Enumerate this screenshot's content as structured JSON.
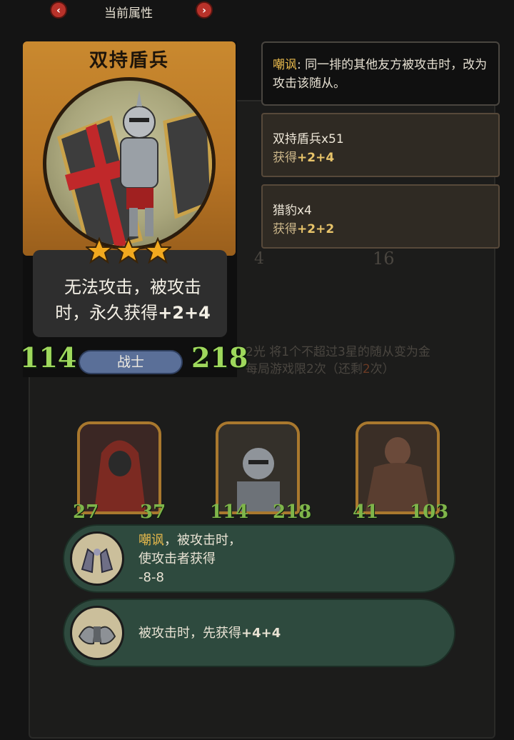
{
  "header": {
    "title": "当前属性",
    "prev_icon": "chevron-left-icon",
    "next_icon": "chevron-right-icon"
  },
  "card": {
    "name": "双持盾兵",
    "stars": 3,
    "description_line1": "无法攻击，被攻击",
    "description_line2_prefix": "时，永久获得",
    "description_line2_bonus": "+2+4",
    "attack": "114",
    "health": "218",
    "class_label": "战士"
  },
  "tooltip": {
    "keyword": "嘲讽",
    "text": ": 同一排的其他友方被攻击时，改为攻击该随从。"
  },
  "sources": [
    {
      "name": "双持盾兵x51",
      "gain_prefix": "获得",
      "gain_value": "+2+4"
    },
    {
      "name": "猎豹x4",
      "gain_prefix": "获得",
      "gain_value": "+2+2"
    }
  ],
  "background": {
    "left_number": "4",
    "right_number": "16",
    "golden_line1": "2光 将1个不超过3星的随从变为金",
    "golden_line2_prefix": "每局游戏限2次（还剩",
    "golden_line2_remaining": "2",
    "golden_line2_suffix": "次）"
  },
  "minions": [
    {
      "attack": "27",
      "health": "37"
    },
    {
      "attack": "114",
      "health": "218"
    },
    {
      "attack": "41",
      "health": "103"
    }
  ],
  "abilities": [
    {
      "icon": "gauntlet-icon",
      "keyword": "嘲讽",
      "line1_rest": "，被攻击时，",
      "line2": "使攻击者获得",
      "line3": "-8-8"
    },
    {
      "icon": "pauldron-icon",
      "text_prefix": "被攻击时，先获得",
      "text_value": "+4+4"
    }
  ],
  "colors": {
    "stat_green": "#9ed85c",
    "keyword_gold": "#e8b94c",
    "ability_bg": "#2e4a3e",
    "card_frame": "#c9892f"
  }
}
